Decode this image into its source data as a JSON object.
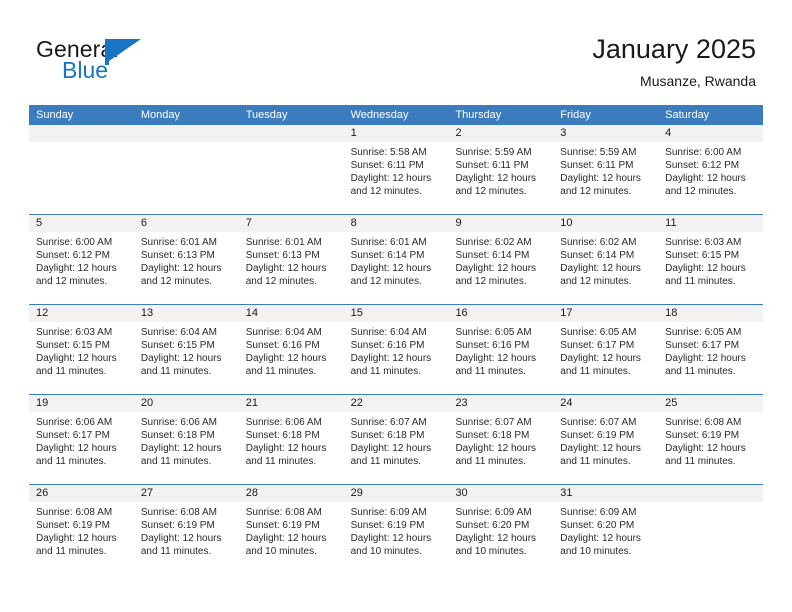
{
  "brand": {
    "word_one": "General",
    "word_two": "Blue",
    "flag_icon": "blue-flag-triangle-icon"
  },
  "header": {
    "title": "January 2025",
    "subtitle": "Musanze, Rwanda"
  },
  "colors": {
    "header_blue": "#3b7cbe",
    "brand_blue": "#1874c4",
    "daynum_band": "#f2f2f2",
    "text": "#1a1a1a"
  },
  "weekdays": [
    "Sunday",
    "Monday",
    "Tuesday",
    "Wednesday",
    "Thursday",
    "Friday",
    "Saturday"
  ],
  "weeks": [
    [
      {
        "day": "",
        "empty": true,
        "lines": []
      },
      {
        "day": "",
        "empty": true,
        "lines": []
      },
      {
        "day": "",
        "empty": true,
        "lines": []
      },
      {
        "day": "1",
        "empty": false,
        "lines": [
          "Sunrise: 5:58 AM",
          "Sunset: 6:11 PM",
          "Daylight: 12 hours",
          "and 12 minutes."
        ]
      },
      {
        "day": "2",
        "empty": false,
        "lines": [
          "Sunrise: 5:59 AM",
          "Sunset: 6:11 PM",
          "Daylight: 12 hours",
          "and 12 minutes."
        ]
      },
      {
        "day": "3",
        "empty": false,
        "lines": [
          "Sunrise: 5:59 AM",
          "Sunset: 6:11 PM",
          "Daylight: 12 hours",
          "and 12 minutes."
        ]
      },
      {
        "day": "4",
        "empty": false,
        "lines": [
          "Sunrise: 6:00 AM",
          "Sunset: 6:12 PM",
          "Daylight: 12 hours",
          "and 12 minutes."
        ]
      }
    ],
    [
      {
        "day": "5",
        "empty": false,
        "lines": [
          "Sunrise: 6:00 AM",
          "Sunset: 6:12 PM",
          "Daylight: 12 hours",
          "and 12 minutes."
        ]
      },
      {
        "day": "6",
        "empty": false,
        "lines": [
          "Sunrise: 6:01 AM",
          "Sunset: 6:13 PM",
          "Daylight: 12 hours",
          "and 12 minutes."
        ]
      },
      {
        "day": "7",
        "empty": false,
        "lines": [
          "Sunrise: 6:01 AM",
          "Sunset: 6:13 PM",
          "Daylight: 12 hours",
          "and 12 minutes."
        ]
      },
      {
        "day": "8",
        "empty": false,
        "lines": [
          "Sunrise: 6:01 AM",
          "Sunset: 6:14 PM",
          "Daylight: 12 hours",
          "and 12 minutes."
        ]
      },
      {
        "day": "9",
        "empty": false,
        "lines": [
          "Sunrise: 6:02 AM",
          "Sunset: 6:14 PM",
          "Daylight: 12 hours",
          "and 12 minutes."
        ]
      },
      {
        "day": "10",
        "empty": false,
        "lines": [
          "Sunrise: 6:02 AM",
          "Sunset: 6:14 PM",
          "Daylight: 12 hours",
          "and 12 minutes."
        ]
      },
      {
        "day": "11",
        "empty": false,
        "lines": [
          "Sunrise: 6:03 AM",
          "Sunset: 6:15 PM",
          "Daylight: 12 hours",
          "and 11 minutes."
        ]
      }
    ],
    [
      {
        "day": "12",
        "empty": false,
        "lines": [
          "Sunrise: 6:03 AM",
          "Sunset: 6:15 PM",
          "Daylight: 12 hours",
          "and 11 minutes."
        ]
      },
      {
        "day": "13",
        "empty": false,
        "lines": [
          "Sunrise: 6:04 AM",
          "Sunset: 6:15 PM",
          "Daylight: 12 hours",
          "and 11 minutes."
        ]
      },
      {
        "day": "14",
        "empty": false,
        "lines": [
          "Sunrise: 6:04 AM",
          "Sunset: 6:16 PM",
          "Daylight: 12 hours",
          "and 11 minutes."
        ]
      },
      {
        "day": "15",
        "empty": false,
        "lines": [
          "Sunrise: 6:04 AM",
          "Sunset: 6:16 PM",
          "Daylight: 12 hours",
          "and 11 minutes."
        ]
      },
      {
        "day": "16",
        "empty": false,
        "lines": [
          "Sunrise: 6:05 AM",
          "Sunset: 6:16 PM",
          "Daylight: 12 hours",
          "and 11 minutes."
        ]
      },
      {
        "day": "17",
        "empty": false,
        "lines": [
          "Sunrise: 6:05 AM",
          "Sunset: 6:17 PM",
          "Daylight: 12 hours",
          "and 11 minutes."
        ]
      },
      {
        "day": "18",
        "empty": false,
        "lines": [
          "Sunrise: 6:05 AM",
          "Sunset: 6:17 PM",
          "Daylight: 12 hours",
          "and 11 minutes."
        ]
      }
    ],
    [
      {
        "day": "19",
        "empty": false,
        "lines": [
          "Sunrise: 6:06 AM",
          "Sunset: 6:17 PM",
          "Daylight: 12 hours",
          "and 11 minutes."
        ]
      },
      {
        "day": "20",
        "empty": false,
        "lines": [
          "Sunrise: 6:06 AM",
          "Sunset: 6:18 PM",
          "Daylight: 12 hours",
          "and 11 minutes."
        ]
      },
      {
        "day": "21",
        "empty": false,
        "lines": [
          "Sunrise: 6:06 AM",
          "Sunset: 6:18 PM",
          "Daylight: 12 hours",
          "and 11 minutes."
        ]
      },
      {
        "day": "22",
        "empty": false,
        "lines": [
          "Sunrise: 6:07 AM",
          "Sunset: 6:18 PM",
          "Daylight: 12 hours",
          "and 11 minutes."
        ]
      },
      {
        "day": "23",
        "empty": false,
        "lines": [
          "Sunrise: 6:07 AM",
          "Sunset: 6:18 PM",
          "Daylight: 12 hours",
          "and 11 minutes."
        ]
      },
      {
        "day": "24",
        "empty": false,
        "lines": [
          "Sunrise: 6:07 AM",
          "Sunset: 6:19 PM",
          "Daylight: 12 hours",
          "and 11 minutes."
        ]
      },
      {
        "day": "25",
        "empty": false,
        "lines": [
          "Sunrise: 6:08 AM",
          "Sunset: 6:19 PM",
          "Daylight: 12 hours",
          "and 11 minutes."
        ]
      }
    ],
    [
      {
        "day": "26",
        "empty": false,
        "lines": [
          "Sunrise: 6:08 AM",
          "Sunset: 6:19 PM",
          "Daylight: 12 hours",
          "and 11 minutes."
        ]
      },
      {
        "day": "27",
        "empty": false,
        "lines": [
          "Sunrise: 6:08 AM",
          "Sunset: 6:19 PM",
          "Daylight: 12 hours",
          "and 11 minutes."
        ]
      },
      {
        "day": "28",
        "empty": false,
        "lines": [
          "Sunrise: 6:08 AM",
          "Sunset: 6:19 PM",
          "Daylight: 12 hours",
          "and 10 minutes."
        ]
      },
      {
        "day": "29",
        "empty": false,
        "lines": [
          "Sunrise: 6:09 AM",
          "Sunset: 6:19 PM",
          "Daylight: 12 hours",
          "and 10 minutes."
        ]
      },
      {
        "day": "30",
        "empty": false,
        "lines": [
          "Sunrise: 6:09 AM",
          "Sunset: 6:20 PM",
          "Daylight: 12 hours",
          "and 10 minutes."
        ]
      },
      {
        "day": "31",
        "empty": false,
        "lines": [
          "Sunrise: 6:09 AM",
          "Sunset: 6:20 PM",
          "Daylight: 12 hours",
          "and 10 minutes."
        ]
      },
      {
        "day": "",
        "empty": true,
        "lines": []
      }
    ]
  ]
}
